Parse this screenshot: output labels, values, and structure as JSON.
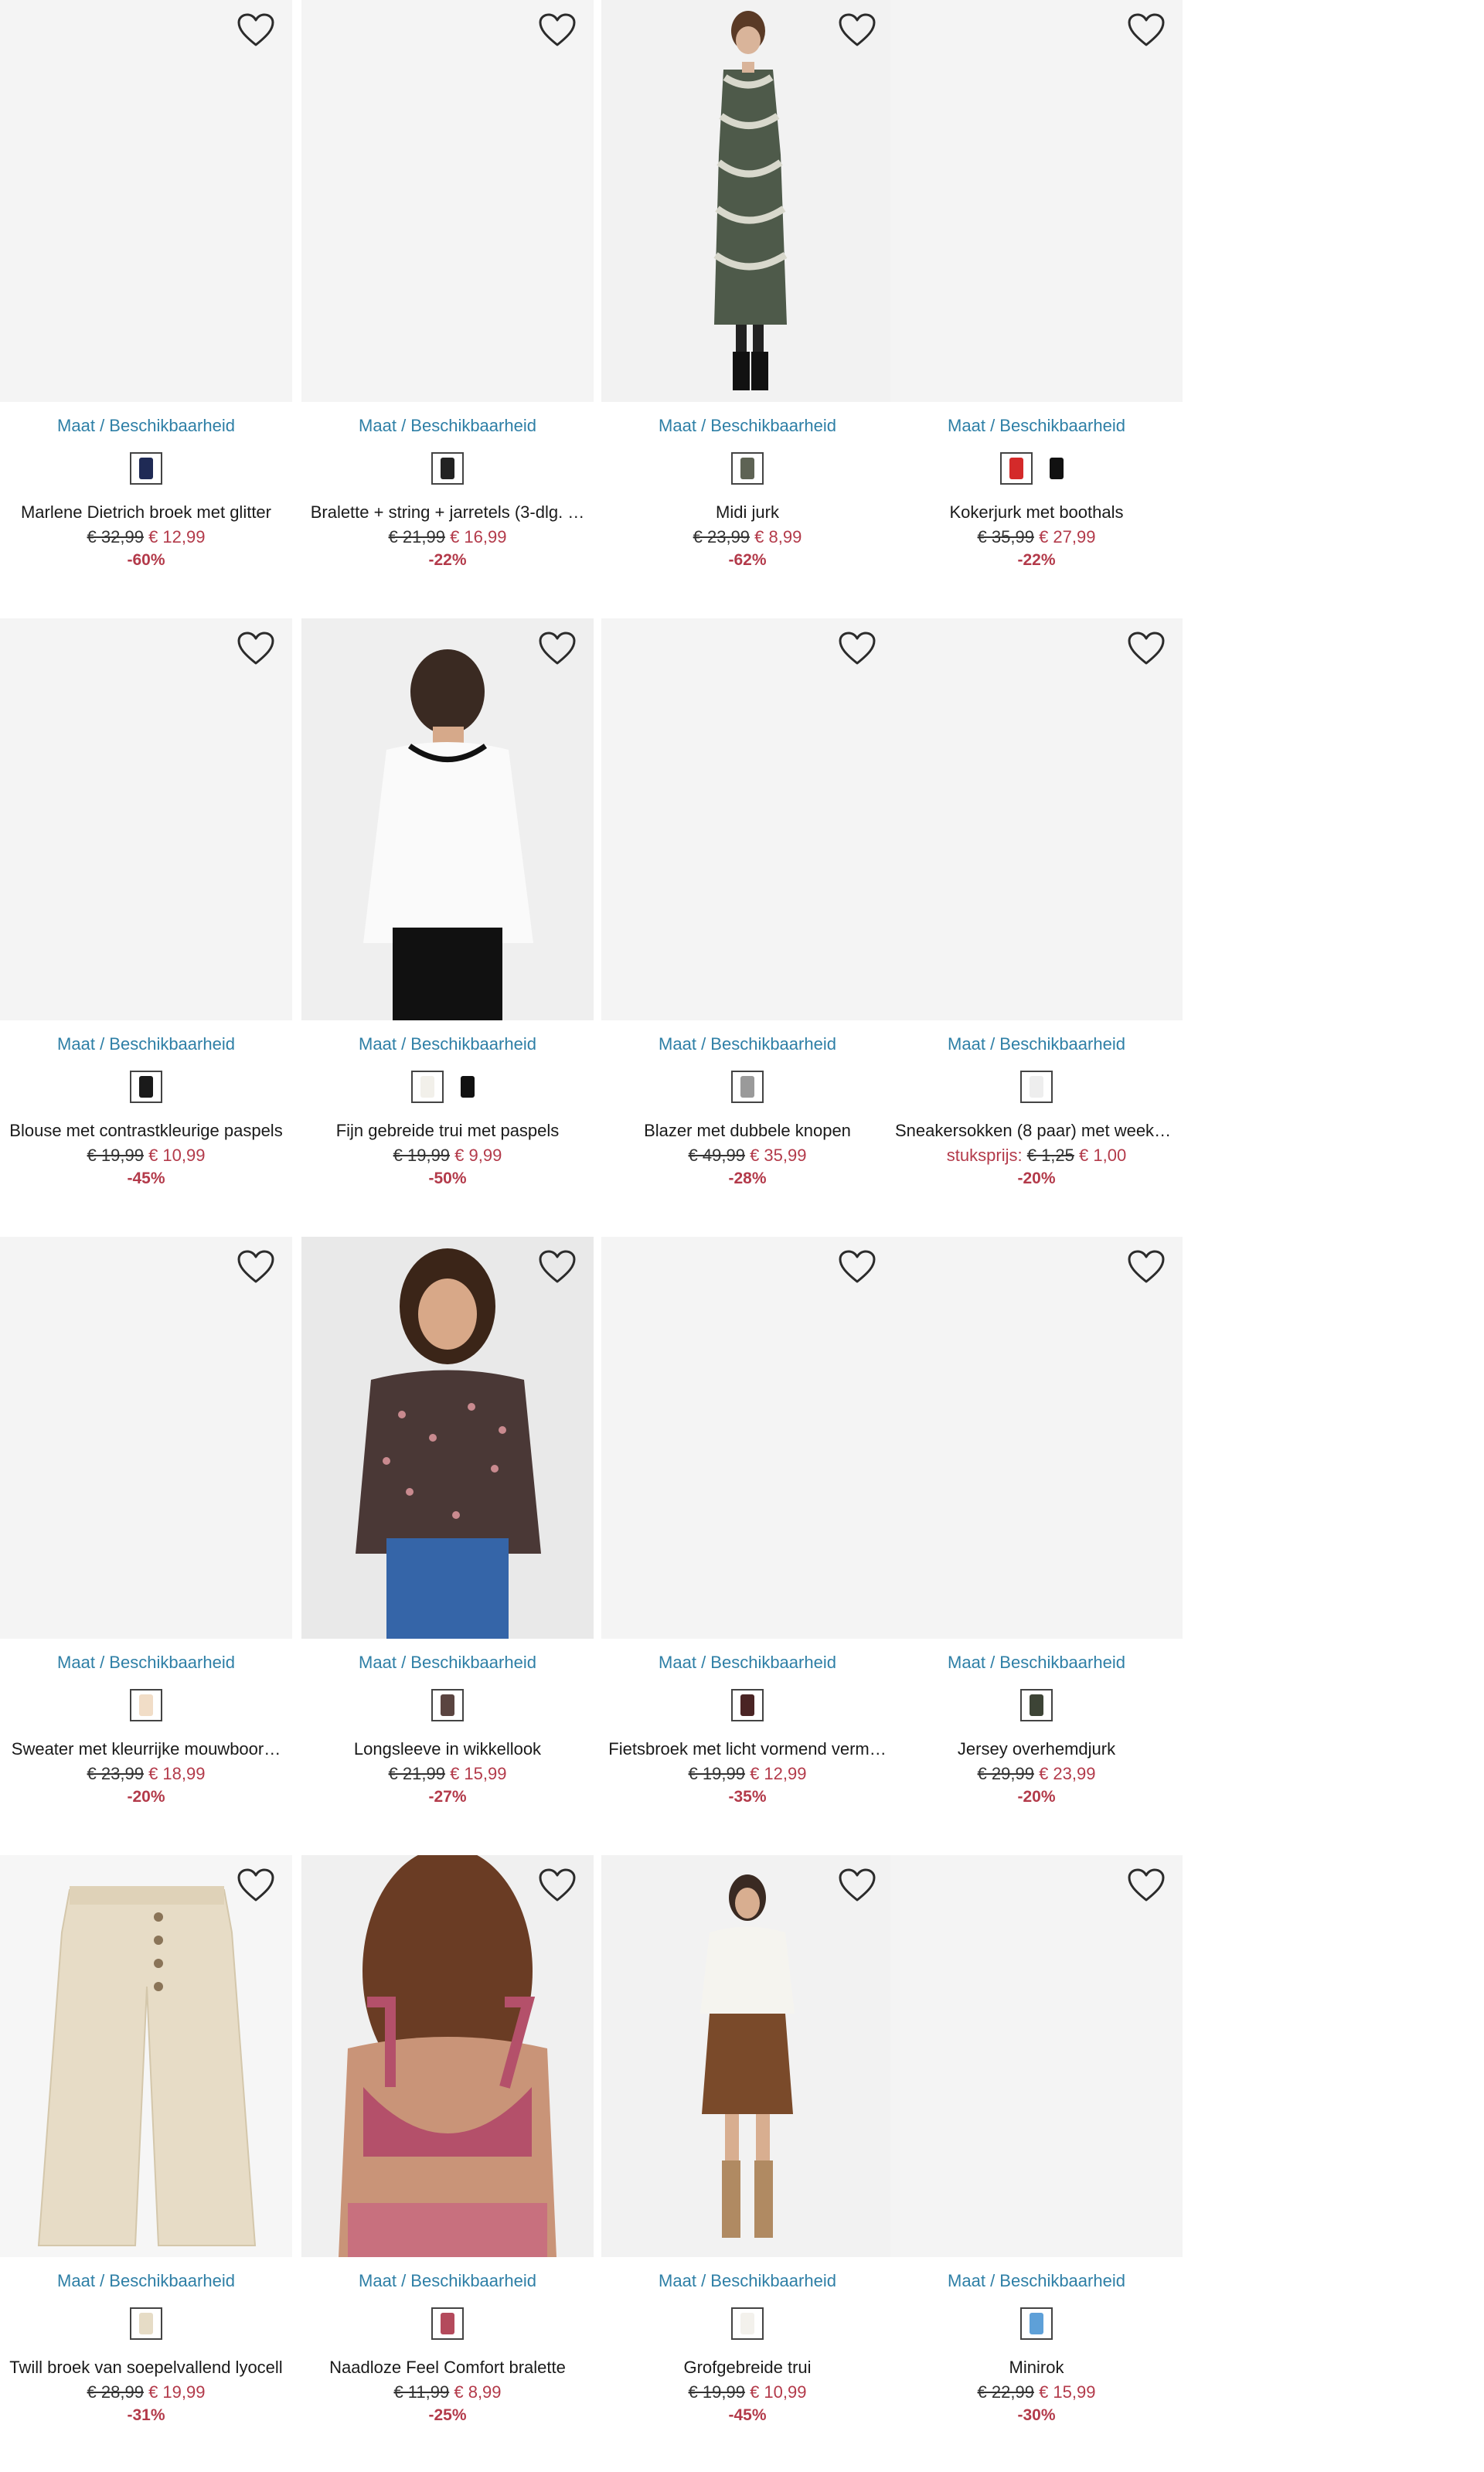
{
  "products": [
    {
      "maat_label": "Maat / Beschikbaarheid",
      "name": "Marlene Dietrich broek met glitter",
      "old_price": "€ 32,99",
      "new_price": "€ 12,99",
      "discount": "-60%",
      "swatches": [
        "#1f2a55"
      ]
    },
    {
      "maat_label": "Maat / Beschikbaarheid",
      "name": "Bralette + string + jarretels (3-dlg. …",
      "old_price": "€ 21,99",
      "new_price": "€ 16,99",
      "discount": "-22%",
      "swatches": [
        "#222222"
      ]
    },
    {
      "maat_label": "Maat / Beschikbaarheid",
      "name": "Midi jurk",
      "old_price": "€ 23,99",
      "new_price": "€ 8,99",
      "discount": "-62%",
      "swatches": [
        "#5e6354"
      ]
    },
    {
      "maat_label": "Maat / Beschikbaarheid",
      "name": "Kokerjurk met boothals",
      "old_price": "€ 35,99",
      "new_price": "€ 27,99",
      "discount": "-22%",
      "swatches": [
        "#d42a2a",
        "#111111"
      ]
    },
    {
      "maat_label": "Maat / Beschikbaarheid",
      "name": "Blouse met contrastkleurige paspels",
      "old_price": "€ 19,99",
      "new_price": "€ 10,99",
      "discount": "-45%",
      "swatches": [
        "#1a1a1a"
      ]
    },
    {
      "maat_label": "Maat / Beschikbaarheid",
      "name": "Fijn gebreide trui met paspels",
      "old_price": "€ 19,99",
      "new_price": "€ 9,99",
      "discount": "-50%",
      "swatches": [
        "#f2f0ea",
        "#111111"
      ]
    },
    {
      "maat_label": "Maat / Beschikbaarheid",
      "name": "Blazer met dubbele knopen",
      "old_price": "€ 49,99",
      "new_price": "€ 35,99",
      "discount": "-28%",
      "swatches": [
        "#9a9a9a"
      ]
    },
    {
      "maat_label": "Maat / Beschikbaarheid",
      "name": "Sneakersokken (8 paar) met weekd…",
      "unit_label": "stuksprijs:",
      "old_price": "€ 1,25",
      "new_price": "€ 1,00",
      "discount": "-20%",
      "swatches": [
        "#eeeeee"
      ]
    },
    {
      "maat_label": "Maat / Beschikbaarheid",
      "name": "Sweater met kleurrijke mouwboor…",
      "old_price": "€ 23,99",
      "new_price": "€ 18,99",
      "discount": "-20%",
      "swatches": [
        "#f1ddc7"
      ]
    },
    {
      "maat_label": "Maat / Beschikbaarheid",
      "name": "Longsleeve in wikkellook",
      "old_price": "€ 21,99",
      "new_price": "€ 15,99",
      "discount": "-27%",
      "swatches": [
        "#5a4440"
      ]
    },
    {
      "maat_label": "Maat / Beschikbaarheid",
      "name": "Fietsbroek met licht vormend verm…",
      "old_price": "€ 19,99",
      "new_price": "€ 12,99",
      "discount": "-35%",
      "swatches": [
        "#4a2424"
      ]
    },
    {
      "maat_label": "Maat / Beschikbaarheid",
      "name": "Jersey overhemdjurk",
      "old_price": "€ 29,99",
      "new_price": "€ 23,99",
      "discount": "-20%",
      "swatches": [
        "#3d4436"
      ]
    },
    {
      "maat_label": "Maat / Beschikbaarheid",
      "name": "Twill broek van soepelvallend lyocell",
      "old_price": "€ 28,99",
      "new_price": "€ 19,99",
      "discount": "-31%",
      "swatches": [
        "#e6dcc6"
      ]
    },
    {
      "maat_label": "Maat / Beschikbaarheid",
      "name": "Naadloze Feel Comfort bralette",
      "old_price": "€ 11,99",
      "new_price": "€ 8,99",
      "discount": "-25%",
      "swatches": [
        "#b44a5c"
      ]
    },
    {
      "maat_label": "Maat / Beschikbaarheid",
      "name": "Grofgebreide trui",
      "old_price": "€ 19,99",
      "new_price": "€ 10,99",
      "discount": "-45%",
      "swatches": [
        "#f3f1ec"
      ]
    },
    {
      "maat_label": "Maat / Beschikbaarheid",
      "name": "Minirok",
      "old_price": "€ 22,99",
      "new_price": "€ 15,99",
      "discount": "-30%",
      "swatches": [
        "#5ea0d8"
      ]
    }
  ]
}
